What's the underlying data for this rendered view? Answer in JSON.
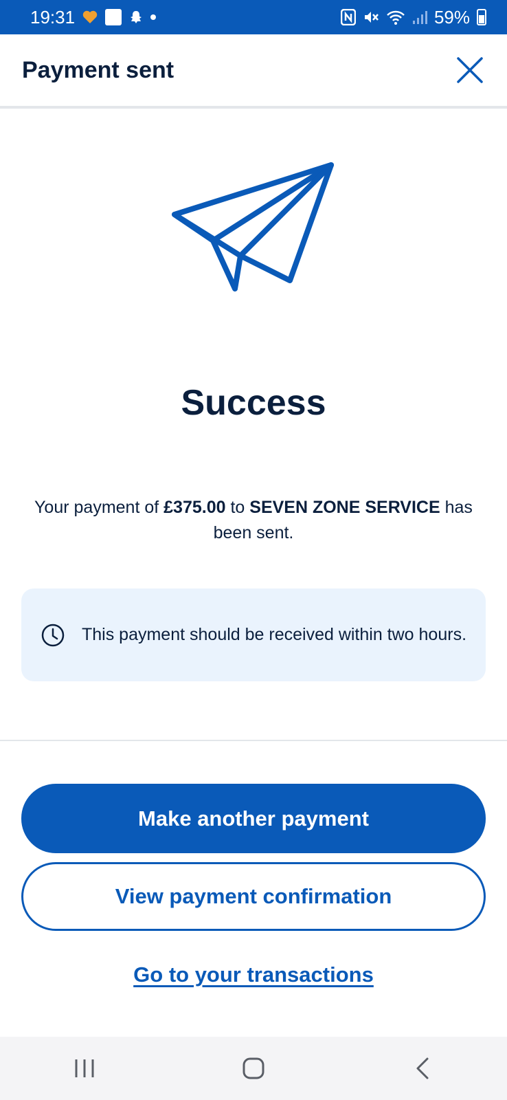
{
  "status_bar": {
    "time": "19:31",
    "battery": "59%"
  },
  "header": {
    "title": "Payment sent",
    "close_icon": "close-icon"
  },
  "illustration": {
    "icon": "paper-plane-icon",
    "color": "#0a5ab8"
  },
  "success": {
    "title": "Success"
  },
  "message": {
    "prefix": "Your payment of ",
    "amount": "£375.00",
    "middle": " to ",
    "payee": "SEVEN ZONE SERVICE",
    "suffix": " has been sent."
  },
  "info": {
    "icon": "clock-icon",
    "text": "This payment should be received within two hours."
  },
  "actions": {
    "primary_label": "Make another payment",
    "secondary_label": "View payment confirmation",
    "link_label": "Go to your transactions"
  },
  "colors": {
    "brand": "#0a5ab8",
    "text": "#0b1f3d",
    "info_bg": "#eaf3fd"
  },
  "nav_bar": {
    "recents_icon": "recents-icon",
    "home_icon": "home-icon",
    "back_icon": "back-icon"
  }
}
